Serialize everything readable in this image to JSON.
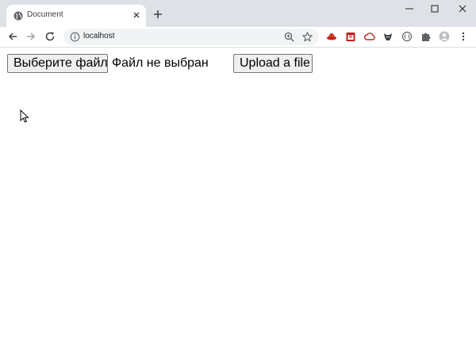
{
  "browser": {
    "tab": {
      "title": "Document",
      "favicon": "globe-icon",
      "close_icon": "close-icon"
    },
    "new_tab_icon": "plus-icon",
    "window_controls": [
      "minimize-icon",
      "maximize-icon",
      "close-icon"
    ],
    "toolbar": {
      "back_icon": "arrow-left-icon",
      "forward_icon": "arrow-right-icon",
      "reload_icon": "reload-icon",
      "site_info_icon": "info-icon",
      "url": "localhost",
      "zoom_icon": "zoom-icon",
      "bookmark_icon": "star-icon",
      "extensions": [
        "redhat-extension-icon",
        "calendar-extension-icon",
        "cloud-extension-icon",
        "dog-extension-icon",
        "circle-extension-icon",
        "puzzle-icon"
      ],
      "profile_icon": "avatar-icon",
      "menu_icon": "kebab-menu-icon"
    }
  },
  "page": {
    "file_input": {
      "button_label": "Выберите файл",
      "status_text": "Файл не выбран"
    },
    "upload_button_label": "Upload a file"
  },
  "colors": {
    "tabstrip_bg": "#dee1e6",
    "omnibox_bg": "#f1f3f4",
    "button_bg": "#efefef",
    "button_border": "#767676",
    "extension_red": "#c5221f"
  }
}
